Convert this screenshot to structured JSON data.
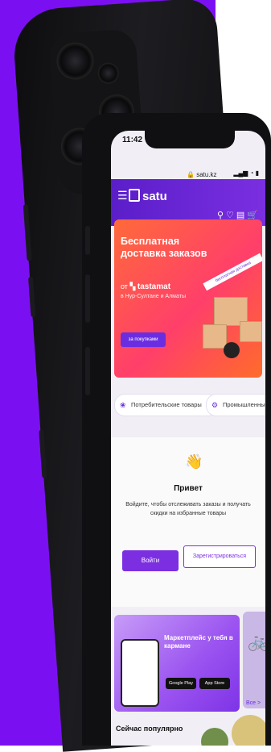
{
  "status_bar": {
    "time": "11:42",
    "url": "satu.kz"
  },
  "header": {
    "brand": "satu"
  },
  "banner": {
    "title": "Бесплатная доставка заказов",
    "brand_prefix": "от",
    "brand": "tastamat",
    "cities": "в Нур-Султане и Алматы",
    "button": "за покупками",
    "ribbon": "бесплатная доставка"
  },
  "categories": [
    "Потребительские товары",
    "Промышленные товары"
  ],
  "greeting": {
    "title": "Привет",
    "subtitle": "Войдите, чтобы отслеживать заказы и получать скидки на избранные товары",
    "login_button": "Войти",
    "register_button": "Зарегистрироваться"
  },
  "promo": {
    "title": "Маркетплейс у тебя в кармане",
    "google_play": "Google Play",
    "app_store": "App Store",
    "all_link": "Все >"
  },
  "popular": {
    "title": "Сейчас популярно"
  },
  "colors": {
    "purple": "#7a10f2",
    "accent": "#7b2fe0",
    "banner_orange": "#ff6a3a"
  }
}
